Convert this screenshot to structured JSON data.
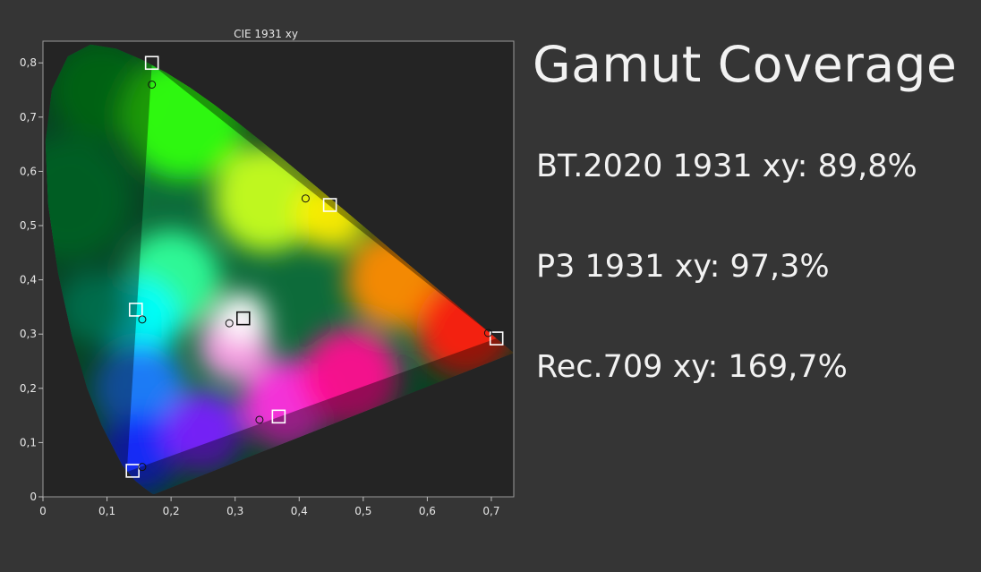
{
  "heading": "Gamut Coverage",
  "stats": [
    "BT.2020 1931 xy: 89,8%",
    "P3 1931 xy: 97,3%",
    "Rec.709 xy: 169,7%"
  ],
  "chart_data": {
    "type": "scatter",
    "title": "CIE 1931 xy",
    "xlabel": "",
    "ylabel": "",
    "xlim": [
      0,
      0.735
    ],
    "ylim": [
      0,
      0.84
    ],
    "x_ticks": [
      "0",
      "0,1",
      "0,2",
      "0,3",
      "0,4",
      "0,5",
      "0,6",
      "0,7"
    ],
    "x_tick_values": [
      0,
      0.1,
      0.2,
      0.3,
      0.4,
      0.5,
      0.6,
      0.7
    ],
    "y_ticks": [
      "0",
      "0,1",
      "0,2",
      "0,3",
      "0,4",
      "0,5",
      "0,6",
      "0,7",
      "0,8"
    ],
    "y_tick_values": [
      0,
      0.1,
      0.2,
      0.3,
      0.4,
      0.5,
      0.6,
      0.7,
      0.8
    ],
    "grid": false,
    "background_color": "#242424",
    "series": [
      {
        "marker": "square",
        "points": [
          {
            "x": 0.17,
            "y": 0.8
          },
          {
            "x": 0.448,
            "y": 0.538
          },
          {
            "x": 0.708,
            "y": 0.292
          },
          {
            "x": 0.14,
            "y": 0.048
          },
          {
            "x": 0.145,
            "y": 0.345
          },
          {
            "x": 0.368,
            "y": 0.148
          },
          {
            "x": 0.3127,
            "y": 0.329
          }
        ]
      },
      {
        "marker": "circle",
        "points": [
          {
            "x": 0.17,
            "y": 0.76
          },
          {
            "x": 0.41,
            "y": 0.55
          },
          {
            "x": 0.695,
            "y": 0.302
          },
          {
            "x": 0.155,
            "y": 0.055
          },
          {
            "x": 0.155,
            "y": 0.327
          },
          {
            "x": 0.338,
            "y": 0.142
          },
          {
            "x": 0.291,
            "y": 0.32
          }
        ]
      }
    ]
  },
  "colors": {
    "page_background": "#353535",
    "plot_background": "#242424",
    "text": "#f2f2f2"
  }
}
